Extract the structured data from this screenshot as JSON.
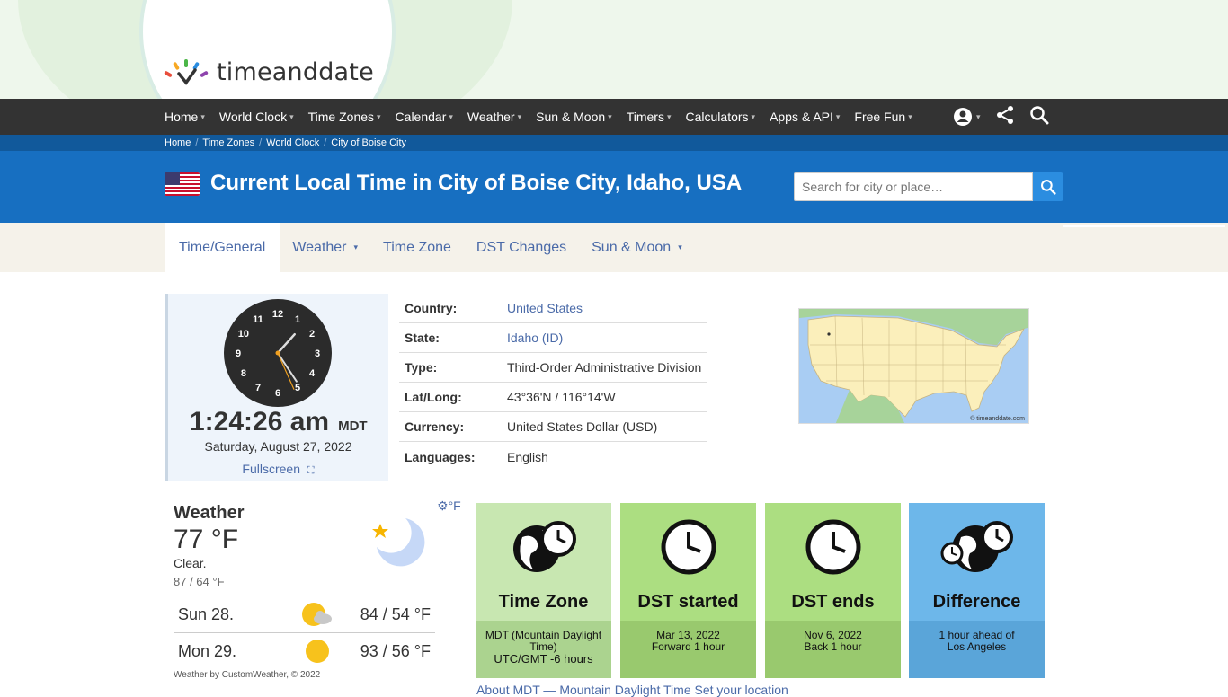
{
  "header": {
    "logo_text": "timeanddate"
  },
  "nav": {
    "items": [
      "Home",
      "World Clock",
      "Time Zones",
      "Calendar",
      "Weather",
      "Sun & Moon",
      "Timers",
      "Calculators",
      "Apps & API",
      "Free Fun"
    ]
  },
  "breadcrumb": [
    "Home",
    "Time Zones",
    "World Clock",
    "City of Boise City"
  ],
  "page": {
    "title": "Current Local Time in City of Boise City, Idaho, USA",
    "search_placeholder": "Search for city or place…"
  },
  "tabs": [
    {
      "label": "Time/General",
      "dropdown": false
    },
    {
      "label": "Weather",
      "dropdown": true
    },
    {
      "label": "Time Zone",
      "dropdown": false
    },
    {
      "label": "DST Changes",
      "dropdown": false
    },
    {
      "label": "Sun & Moon",
      "dropdown": true
    }
  ],
  "clock": {
    "numbers": [
      "12",
      "1",
      "2",
      "3",
      "4",
      "5",
      "6",
      "7",
      "8",
      "9",
      "10",
      "11"
    ],
    "time": "1:24:26 am",
    "tz": "MDT",
    "date": "Saturday, August 27, 2022",
    "fullscreen": "Fullscreen"
  },
  "info": [
    {
      "key": "Country:",
      "value": "United States",
      "link": true
    },
    {
      "key": "State:",
      "value": "Idaho (ID)",
      "link": true
    },
    {
      "key": "Type:",
      "value": "Third-Order Administrative Division",
      "link": false
    },
    {
      "key": "Lat/Long:",
      "value": "43°36'N / 116°14'W",
      "link": false
    },
    {
      "key": "Currency:",
      "value": "United States Dollar (USD)",
      "link": false
    },
    {
      "key": "Languages:",
      "value": "English",
      "link": false
    }
  ],
  "map": {
    "credit": "© timeanddate.com"
  },
  "weather": {
    "title": "Weather",
    "temp": "77 °F",
    "desc": "Clear.",
    "range": "87 / 64 °F",
    "unit": "°F",
    "forecast": [
      {
        "day": "Sun 28.",
        "temps": "84 / 54 °F",
        "icon": "partly-cloudy-icon"
      },
      {
        "day": "Mon 29.",
        "temps": "93 / 56 °F",
        "icon": "sun-icon"
      }
    ],
    "credit": "Weather by CustomWeather, © 2022"
  },
  "cards": [
    {
      "title": "Time Zone",
      "body": [
        "MDT (Mountain Daylight",
        "Time)",
        "UTC/GMT -6 hours"
      ]
    },
    {
      "title": "DST started",
      "body": [
        "Mar 13, 2022",
        "Forward 1 hour"
      ]
    },
    {
      "title": "DST ends",
      "body": [
        "Nov 6, 2022",
        "Back 1 hour"
      ]
    },
    {
      "title": "Difference",
      "body": [
        "1 hour ahead of",
        "Los Angeles"
      ]
    }
  ],
  "below_cards": "About MDT — Mountain Daylight Time     Set your location"
}
